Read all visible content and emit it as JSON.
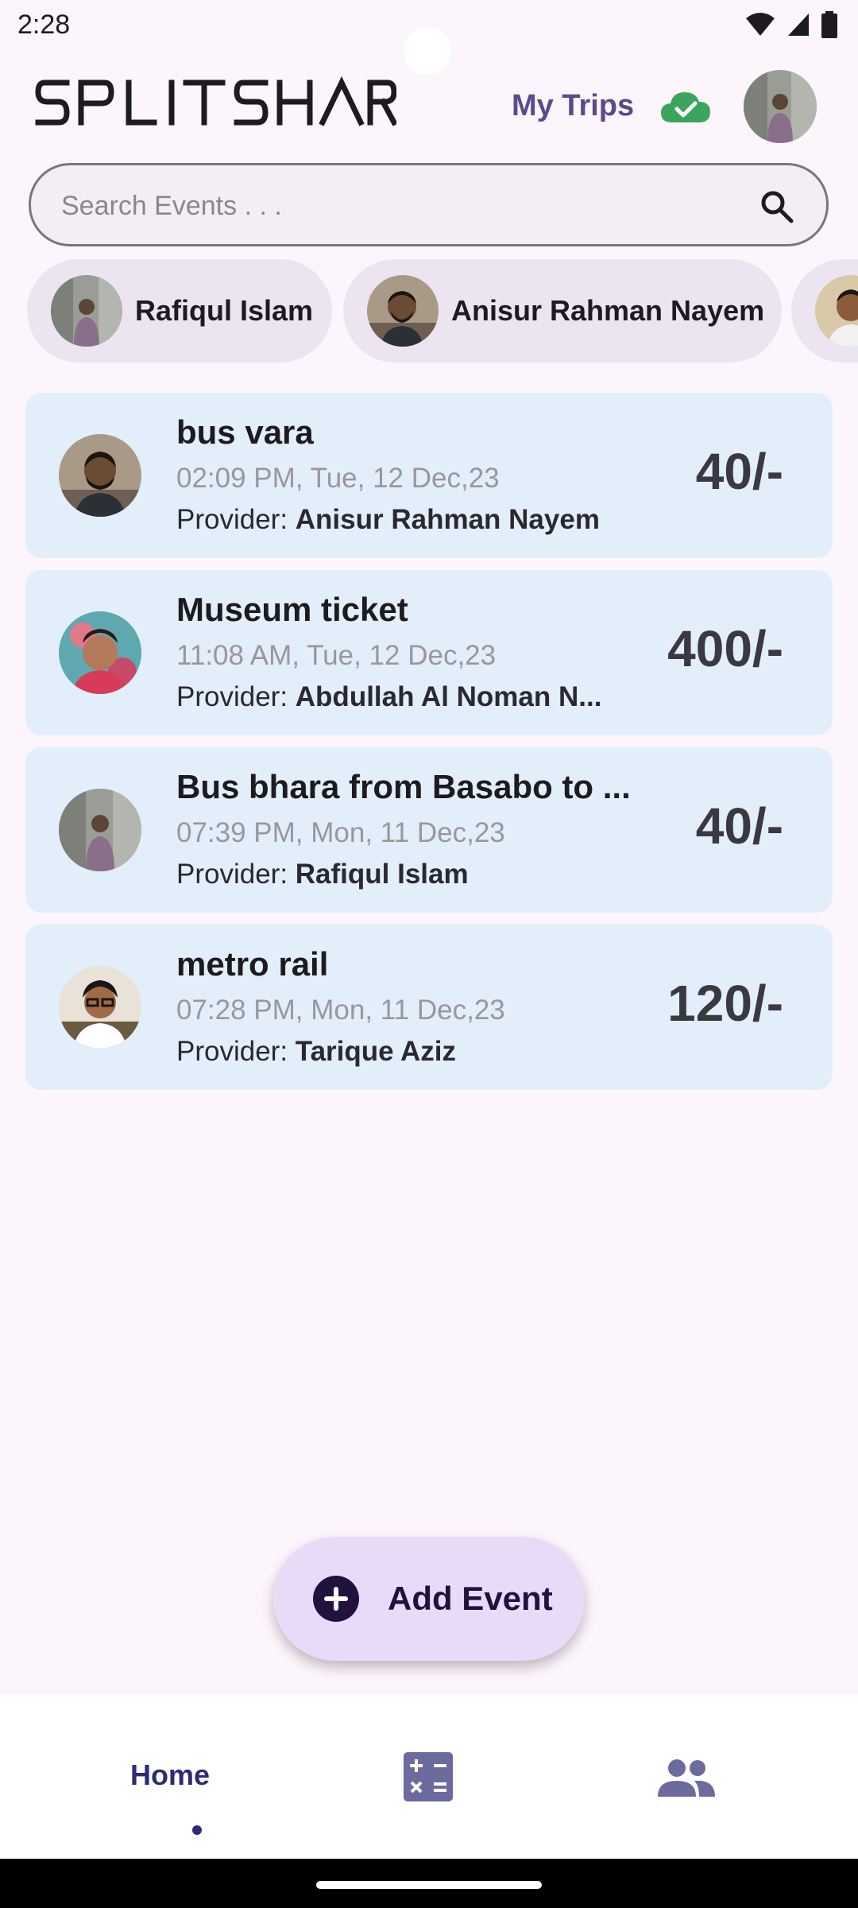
{
  "status_bar": {
    "time": "2:28"
  },
  "header": {
    "app_name": "SPLITSHARE",
    "my_trips_label": "My Trips",
    "sync_status": "synced"
  },
  "search": {
    "placeholder": "Search Events . . ."
  },
  "members": [
    {
      "name": "Rafiqul Islam"
    },
    {
      "name": "Anisur Rahman Nayem"
    },
    {
      "name": ""
    }
  ],
  "events": [
    {
      "title": "bus vara",
      "time": "02:09 PM, Tue, 12 Dec,23",
      "provider_label": "Provider: ",
      "provider": "Anisur Rahman Nayem",
      "amount": "40/-"
    },
    {
      "title": "Museum ticket",
      "time": "11:08 AM, Tue, 12 Dec,23",
      "provider_label": "Provider: ",
      "provider": "Abdullah Al Noman N...",
      "amount": "400/-"
    },
    {
      "title": "Bus bhara from Basabo to ...",
      "time": "07:39 PM, Mon, 11 Dec,23",
      "provider_label": "Provider: ",
      "provider": "Rafiqul Islam",
      "amount": "40/-"
    },
    {
      "title": "metro rail",
      "time": "07:28 PM, Mon, 11 Dec,23",
      "provider_label": "Provider: ",
      "provider": "Tarique Aziz",
      "amount": "120/-"
    }
  ],
  "fab": {
    "label": "Add Event"
  },
  "bottom_nav": {
    "home_label": "Home",
    "calculator_icon": "calculator-icon",
    "people_icon": "people-icon"
  },
  "colors": {
    "background": "#fdf5fc",
    "card": "#e2eef9",
    "accent": "#5b4a8c",
    "fab": "#e9dbf7",
    "nav_active": "#2d2a7a"
  }
}
